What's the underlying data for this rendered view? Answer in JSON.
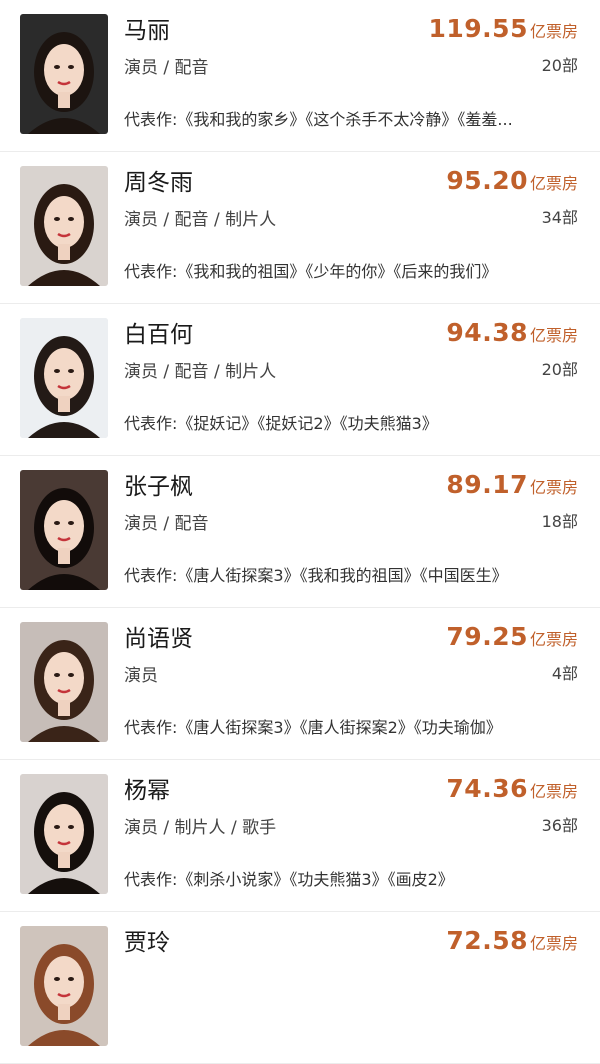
{
  "unit": "亿票房",
  "colors": {
    "accent": "#c0602b"
  },
  "items": [
    {
      "name": "马丽",
      "roles": "演员 / 配音",
      "box_office": "119.55",
      "films": "20部",
      "works": "代表作:《我和我的家乡》《这个杀手不太冷静》《羞羞...",
      "avatar_bg": "#2b2b2b",
      "hair": "#1c1410"
    },
    {
      "name": "周冬雨",
      "roles": "演员 / 配音 / 制片人",
      "box_office": "95.20",
      "films": "34部",
      "works": "代表作:《我和我的祖国》《少年的你》《后来的我们》",
      "avatar_bg": "#d9d3cf",
      "hair": "#2a1a12"
    },
    {
      "name": "白百何",
      "roles": "演员 / 配音 / 制片人",
      "box_office": "94.38",
      "films": "20部",
      "works": "代表作:《捉妖记》《捉妖记2》《功夫熊猫3》",
      "avatar_bg": "#eceff2",
      "hair": "#231a16"
    },
    {
      "name": "张子枫",
      "roles": "演员 / 配音",
      "box_office": "89.17",
      "films": "18部",
      "works": "代表作:《唐人街探案3》《我和我的祖国》《中国医生》",
      "avatar_bg": "#4a3a34",
      "hair": "#120c0a"
    },
    {
      "name": "尚语贤",
      "roles": "演员",
      "box_office": "79.25",
      "films": "4部",
      "works": "代表作:《唐人街探案3》《唐人街探案2》《功夫瑜伽》",
      "avatar_bg": "#c6bdb8",
      "hair": "#3a2418"
    },
    {
      "name": "杨幂",
      "roles": "演员 / 制片人 / 歌手",
      "box_office": "74.36",
      "films": "36部",
      "works": "代表作:《刺杀小说家》《功夫熊猫3》《画皮2》",
      "avatar_bg": "#d8d2cf",
      "hair": "#150f0c"
    },
    {
      "name": "贾玲",
      "roles": "",
      "box_office": "72.58",
      "films": "",
      "works": "",
      "avatar_bg": "#cfc4bc",
      "hair": "#8a4a2a"
    }
  ]
}
